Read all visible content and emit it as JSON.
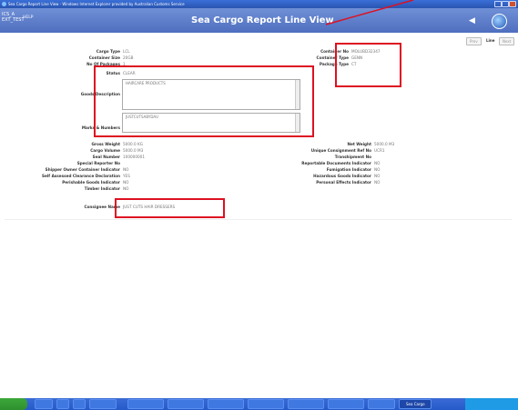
{
  "window": {
    "title": "Sea Cargo Report Line View - Windows Internet Explorer provided by Australian Customs Service"
  },
  "header": {
    "user": [
      "ICS_A",
      "EXT_TEST"
    ],
    "help": "HELP",
    "title": "Sea Cargo Report Line View"
  },
  "nav": {
    "prev": "Prev",
    "line": "Line",
    "next": "Next"
  },
  "left_fields": [
    {
      "label": "Cargo Type",
      "value": "LCL"
    },
    {
      "label": "Container Size",
      "value": "20GB"
    },
    {
      "label": "No Of Packages",
      "value": "1"
    },
    {
      "label": "Status",
      "value": "CLEAR"
    }
  ],
  "right_fields": [
    {
      "label": "Container No",
      "value": "MOLUBD32347"
    },
    {
      "label": "Container Type",
      "value": "GENN"
    },
    {
      "label": "Package Type",
      "value": "CT"
    }
  ],
  "goods_description": {
    "label": "Goods Description",
    "value": "HAIRCARE PRODUCTS"
  },
  "marks_numbers": {
    "label": "Marks & Numbers",
    "value": "JUSTCUTSABYDAU"
  },
  "lower_left": [
    {
      "label": "Gross Weight",
      "value": "5000.0 KG"
    },
    {
      "label": "Cargo Volume",
      "value": "5000.0 M3"
    },
    {
      "label": "Seal Number",
      "value": "100000001"
    },
    {
      "label": "Special Reporter No",
      "value": ""
    },
    {
      "label": "Shipper Owner Container Indicator",
      "value": "NO"
    },
    {
      "label": "Self Assessed Clearance Declaration",
      "value": "YES"
    },
    {
      "label": "Perishable Goods Indicator",
      "value": "NO"
    },
    {
      "label": "Timber Indicator",
      "value": "NO"
    },
    {
      "label": "Consignee Name",
      "value": "JUST CUTS HAIR DRESSERS"
    }
  ],
  "lower_right": [
    {
      "label": "Net Weight",
      "value": "5000.0 M3"
    },
    {
      "label": "Unique Consignment Ref No",
      "value": "UCR1"
    },
    {
      "label": "Transhipment No",
      "value": ""
    },
    {
      "label": "Reportable Documents Indicator",
      "value": "NO"
    },
    {
      "label": "Fumigation Indicator",
      "value": "NO"
    },
    {
      "label": "Hazardous Goods Indicator",
      "value": "NO"
    },
    {
      "label": "Personal Effects Indicator",
      "value": "NO"
    }
  ],
  "taskbar": {
    "active_task": "Sea Cargo"
  },
  "colors": {
    "header": "#5b7cc8",
    "highlight": "#dd1122",
    "taskbar": "#245ac8"
  }
}
